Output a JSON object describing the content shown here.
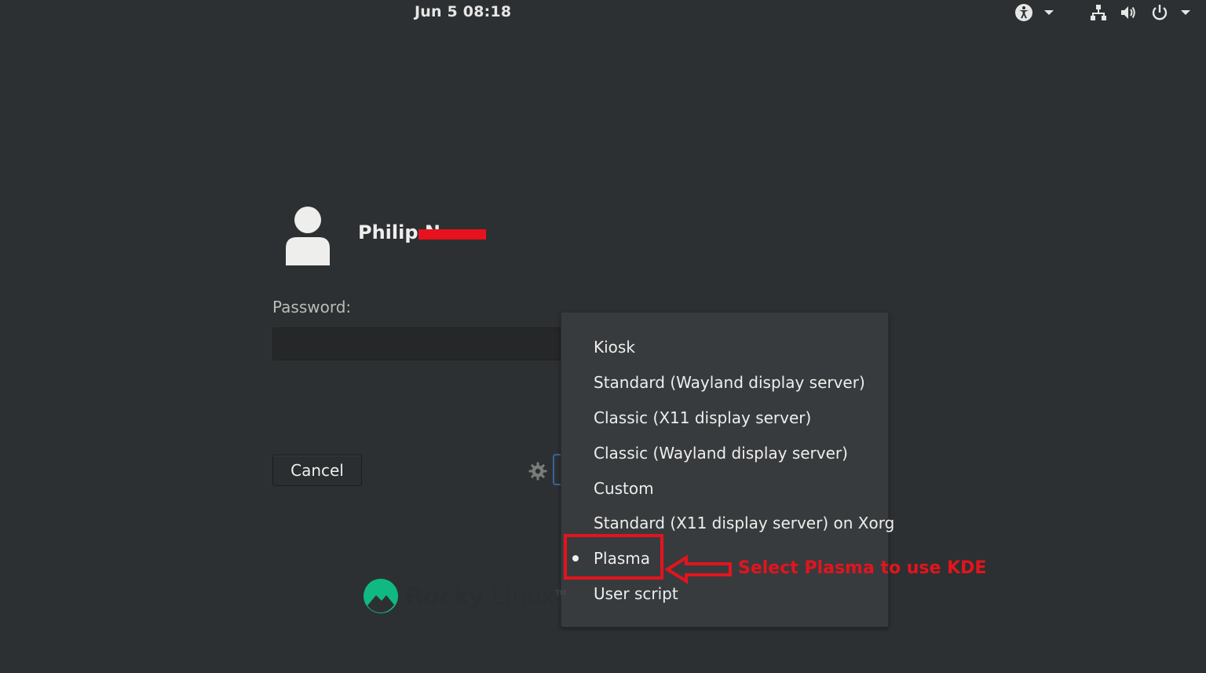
{
  "topbar": {
    "clock": "Jun 5  08:18",
    "icons": [
      "accessibility-icon",
      "chevron-down-icon",
      "network-icon",
      "volume-icon",
      "power-icon",
      "chevron-down-icon"
    ]
  },
  "user": {
    "name": "Philip N",
    "avatar_icon": "user-avatar-icon"
  },
  "login": {
    "password_label": "Password:",
    "password_value": "",
    "cancel_label": "Cancel",
    "settings_icon": "gear-icon"
  },
  "session_menu": {
    "items": [
      {
        "label": "Kiosk",
        "selected": false
      },
      {
        "label": "Standard (Wayland display server)",
        "selected": false
      },
      {
        "label": "Classic (X11 display server)",
        "selected": false
      },
      {
        "label": "Classic (Wayland display server)",
        "selected": false
      },
      {
        "label": "Custom",
        "selected": false
      },
      {
        "label": "Standard (X11 display server) on Xorg",
        "selected": false
      },
      {
        "label": "Plasma",
        "selected": true
      },
      {
        "label": "User script",
        "selected": false
      }
    ]
  },
  "annotation": {
    "text": "Select Plasma to use KDE",
    "color": "#e3141d"
  },
  "logo": {
    "word1": "Rocky",
    "word2": "Linux",
    "tm": "TM",
    "accent": "#10b981"
  }
}
